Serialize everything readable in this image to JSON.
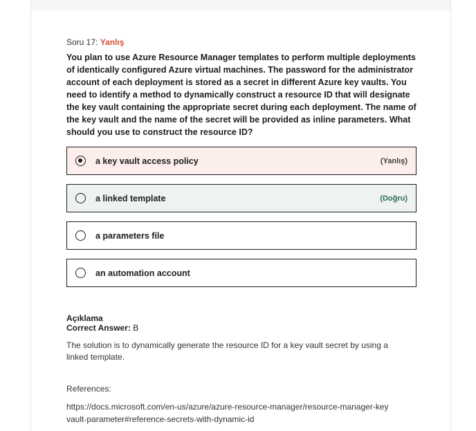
{
  "question": {
    "number_label": "Soru 17:",
    "status": "Yanlış",
    "text": "You plan to use Azure Resource Manager templates to perform multiple deployments of identically configured Azure virtual machines. The password for the administrator account of each deployment is stored as a secret in different Azure key vaults. You need to identify a method to dynamically construct a resource ID that will designate the key vault containing the appropriate secret during each deployment. The name of the key vault and the name of the secret will be provided as inline parameters. What should you use to construct the resource ID?"
  },
  "options": [
    {
      "label": "a key vault access policy",
      "tag": "(Yanlış)",
      "selected": true
    },
    {
      "label": "a linked template",
      "tag": "(Doğru)",
      "selected": false
    },
    {
      "label": "a parameters file",
      "tag": "",
      "selected": false
    },
    {
      "label": "an automation account",
      "tag": "",
      "selected": false
    }
  ],
  "explanation": {
    "title": "Açıklama",
    "correct_answer_label": "Correct Answer:",
    "correct_answer_value": "B",
    "body": "The solution is to dynamically generate the resource ID for a key vault secret by using a linked template."
  },
  "references": {
    "label": "References:",
    "link": "https://docs.microsoft.com/en-us/azure/azure-resource-manager/resource-manager-keyvault-parameter#reference-secrets-with-dynamic-id"
  },
  "colors": {
    "wrong": "#d4523a",
    "incorrect_bg": "#fceeea",
    "correct_bg": "#eef3f1"
  }
}
